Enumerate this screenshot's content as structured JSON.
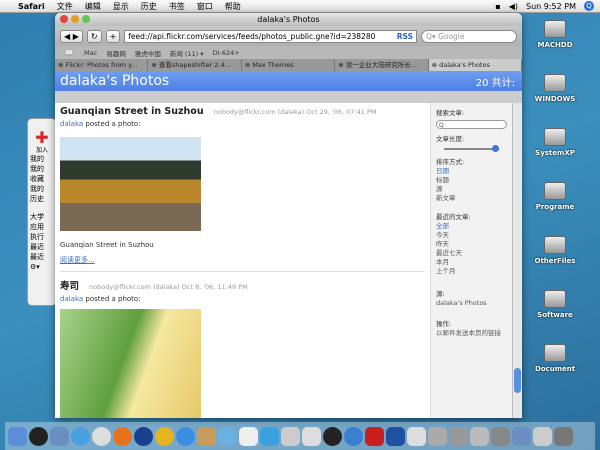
{
  "menubar": {
    "app": "Safari",
    "items": [
      "文件",
      "编辑",
      "显示",
      "历史",
      "书签",
      "窗口",
      "帮助"
    ],
    "clock": "Sun 9:52 PM"
  },
  "window": {
    "title": "dalaka's Photos",
    "url": "feed://api.flickr.com/services/feeds/photos_public.gne?id=238280",
    "rss": "RSS",
    "search_placeholder": "Google",
    "bookmarks": [
      ".Mac",
      "易趣网",
      "雅虎中国",
      "新闻 (11) ▾",
      "DI-624+"
    ],
    "tabs": [
      "Flickr: Photos from y...",
      "查看shapeshifter 2.4...",
      "Max Themes",
      "读一企业大陆研究所长...",
      "dalaka's Photos"
    ]
  },
  "page": {
    "title": "dalaka's Photos",
    "count": "20 共计:",
    "posts": [
      {
        "title": "Guanqian Street in Suzhou",
        "meta": "nobody@flickr.com (dalaka)   Oct 29, '06, 07:41 PM",
        "author": "dalaka",
        "posted": " posted a photo:",
        "caption": "Guanqian Street in Suzhou",
        "more": "阅读更多..."
      },
      {
        "title": "寿司",
        "meta": "nobody@flickr.com (dalaka)   Oct 8, '06, 11:49 PM",
        "author": "dalaka",
        "posted": " posted a photo:"
      }
    ]
  },
  "sidebar": {
    "search_label": "搜索文章:",
    "length_label": "文章长度:",
    "length_value": 1.0,
    "sort_label": "排序方式:",
    "sort": [
      "日期",
      "标题",
      "源",
      "新文章"
    ],
    "recent_label": "最近的文章:",
    "recent": [
      "全部",
      "今天",
      "昨天",
      "最近七天",
      "本月",
      "上个月"
    ],
    "source_label": "源:",
    "source": "dalaka's Photos",
    "action_label": "操作:",
    "action": "以邮件发送本页的链接"
  },
  "panel": {
    "add": "加入",
    "items": [
      "我的",
      "我的",
      "收藏",
      "我的",
      "历史"
    ],
    "items2": [
      "大学",
      "应用",
      "执行",
      "最近",
      "最近"
    ]
  },
  "desktop": [
    "MACHDD",
    "WINDOWS",
    "SystemXP",
    "Programe",
    "OtherFiles",
    "Software",
    "Document"
  ]
}
